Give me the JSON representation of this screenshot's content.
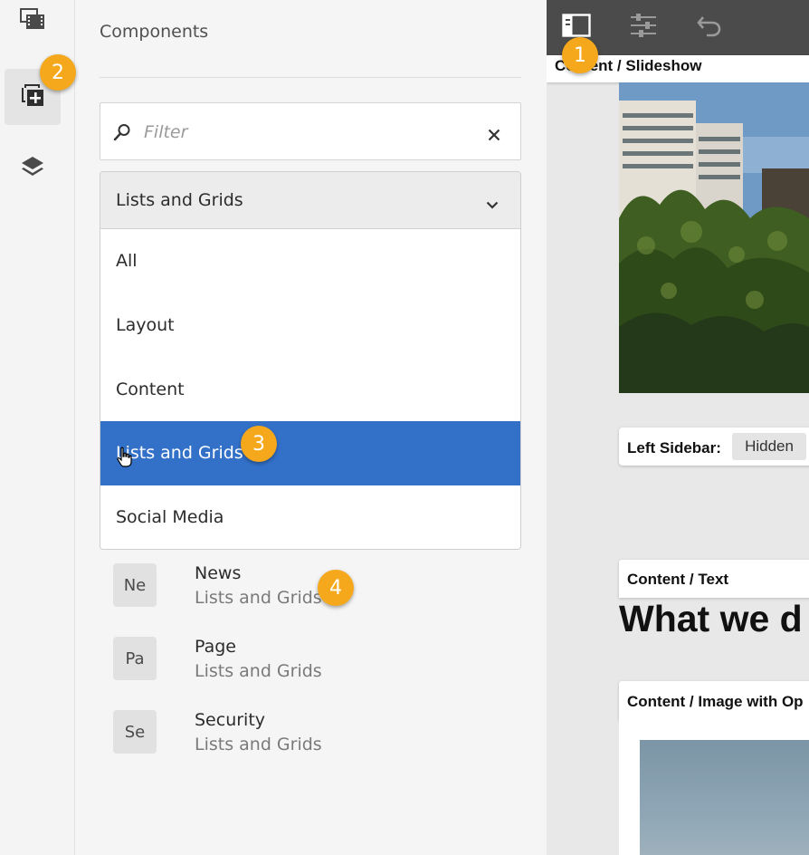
{
  "panel": {
    "title": "Components",
    "filter": {
      "placeholder": "Filter",
      "value": ""
    },
    "group_select": {
      "selected": "Lists and Grids",
      "options": [
        "All",
        "Layout",
        "Content",
        "Lists and Grids",
        "Social Media"
      ],
      "highlighted_index": 3
    },
    "components": [
      {
        "badge": "Ne",
        "name": "News",
        "group": "Lists and Grids"
      },
      {
        "badge": "Pa",
        "name": "Page",
        "group": "Lists and Grids"
      },
      {
        "badge": "Se",
        "name": "Security",
        "group": "Lists and Grids"
      }
    ]
  },
  "rail": {
    "items": [
      {
        "icon": "assets-icon"
      },
      {
        "icon": "components-icon",
        "active": true
      },
      {
        "icon": "layers-icon"
      }
    ]
  },
  "toolbar": {
    "icons": [
      "toggle-side-panel-icon",
      "page-properties-icon",
      "undo-icon"
    ]
  },
  "editor": {
    "slideshow_label": "Content / Slideshow",
    "sidebar_label": "Left Sidebar:",
    "sidebar_value": "Hidden",
    "text_label": "Content / Text",
    "heading": "What we d",
    "image_label": "Content / Image with Op"
  },
  "callouts": [
    "1",
    "2",
    "3",
    "4"
  ],
  "colors": {
    "accent": "#3371c9",
    "callout": "#f5a81c",
    "toolbar": "#4b4b4b"
  }
}
